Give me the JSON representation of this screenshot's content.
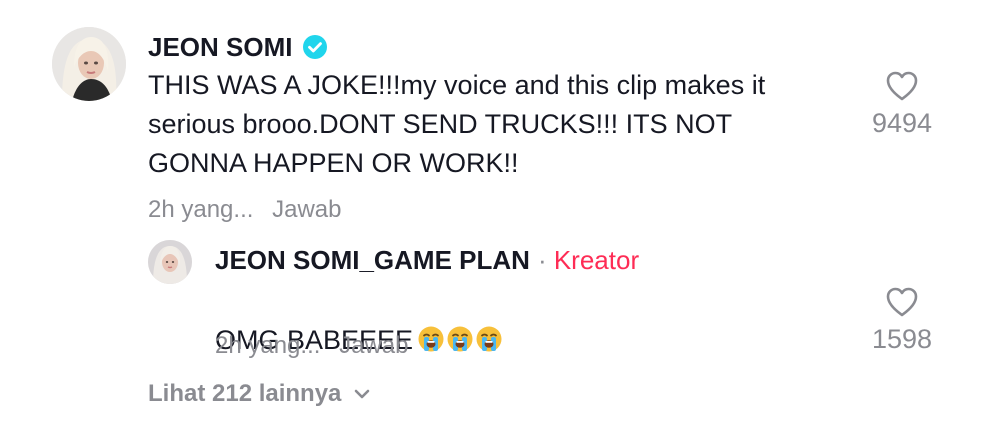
{
  "comment": {
    "username": "JEON SOMI",
    "verified": true,
    "text": "THIS WAS A JOKE!!!my voice and this clip makes it\nserious brooo.DONT SEND TRUCKS!!! ITS NOT\nGONNA HAPPEN OR WORK!!",
    "time": "2h yang...",
    "reply_label": "Jawab",
    "likes": "9494",
    "avatar_icon": "profile-photo"
  },
  "reply": {
    "username": "JEON SOMI_GAME PLAN",
    "separator": "·",
    "creator_label": "Kreator",
    "text": "OMG BABEEEE",
    "emojis": [
      "loudly-crying-face",
      "loudly-crying-face",
      "loudly-crying-face"
    ],
    "time": "2h yang...",
    "reply_label": "Jawab",
    "likes": "1598",
    "avatar_icon": "profile-photo"
  },
  "view_more": {
    "label": "Lihat 212 lainnya"
  },
  "colors": {
    "text_primary": "#161823",
    "text_secondary": "#8a8b91",
    "creator_accent": "#fe2c55",
    "verified_badge": "#20d5ec"
  }
}
